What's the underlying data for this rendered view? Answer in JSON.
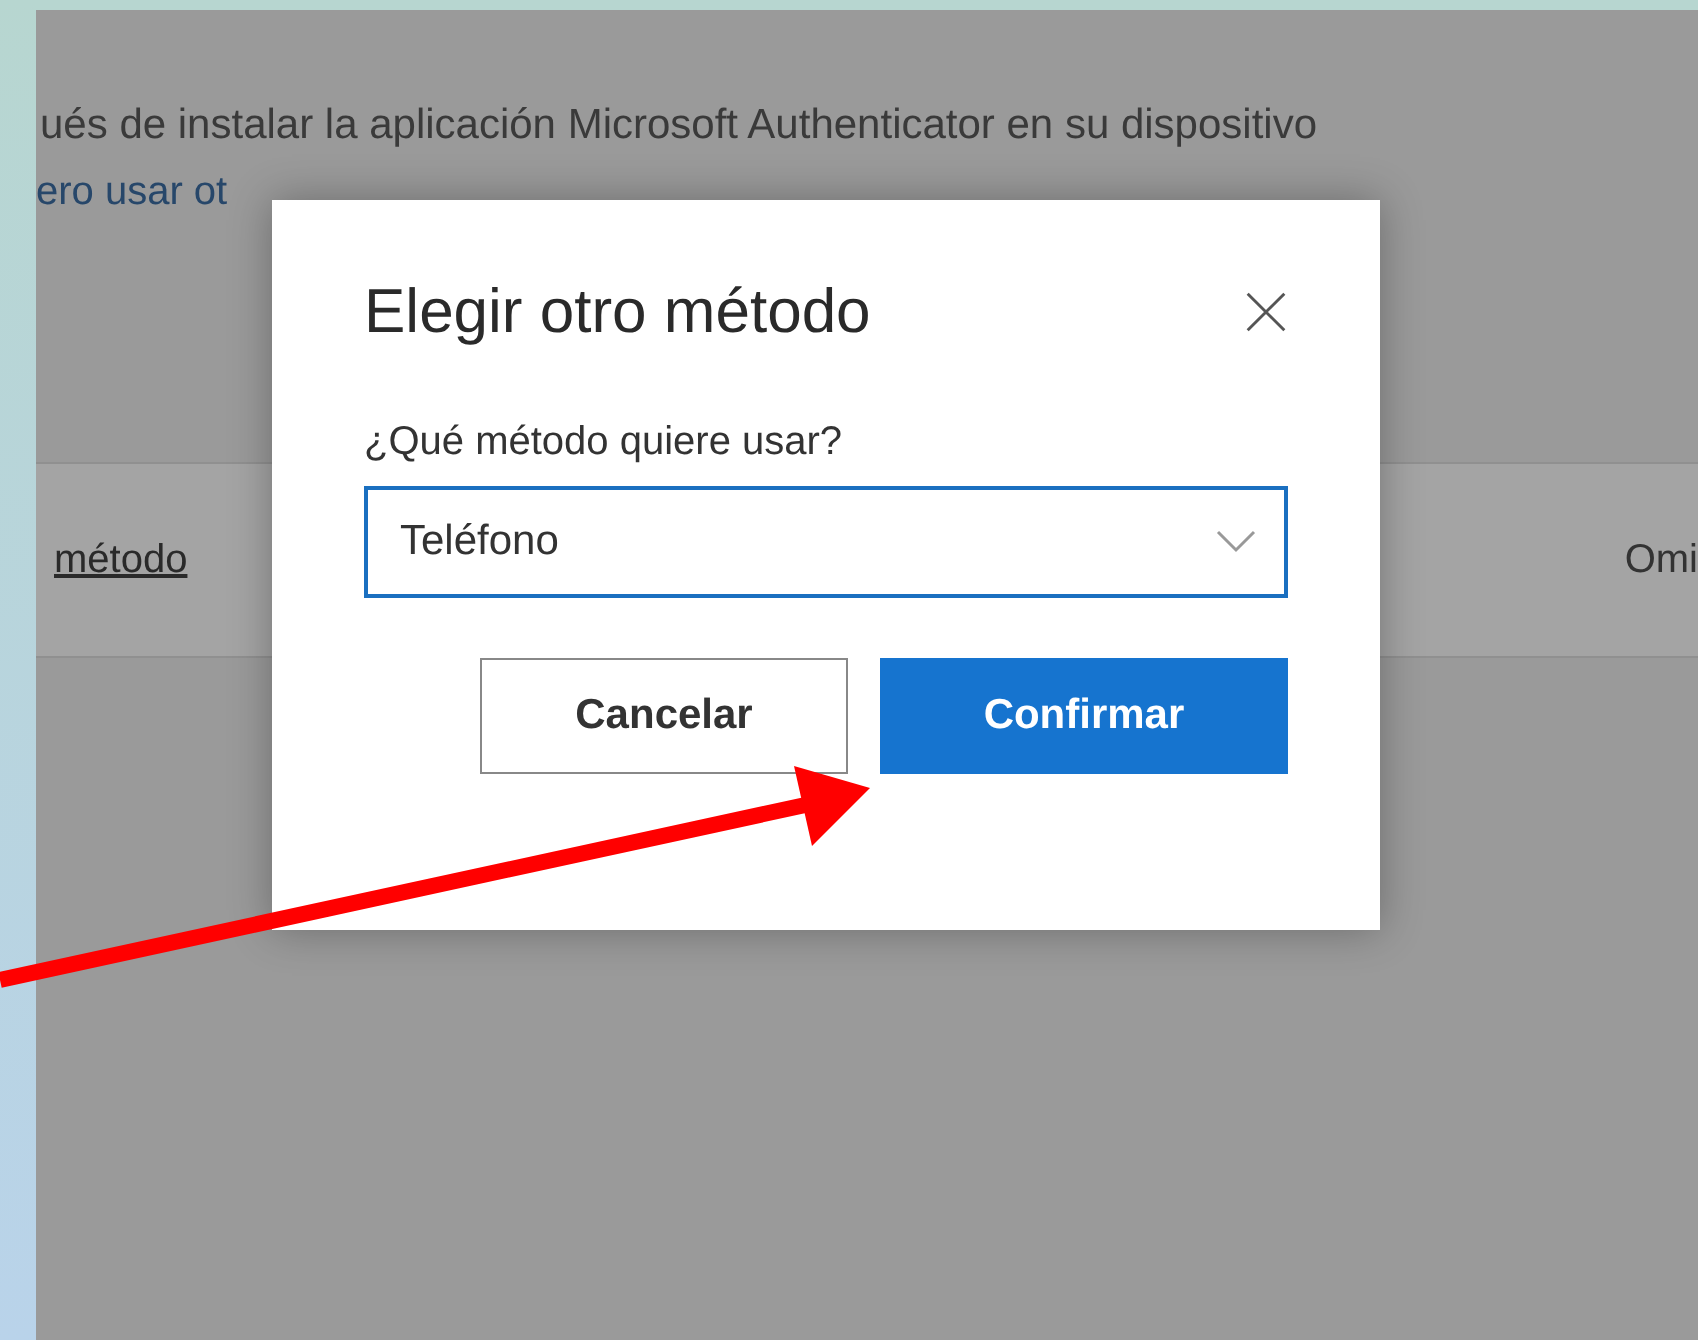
{
  "background": {
    "intro_text": "ués de instalar la aplicación Microsoft Authenticator en su dispositivo",
    "link": "ero usar ot",
    "band": {
      "link": "método",
      "action": "Omi"
    }
  },
  "dialog": {
    "title": "Elegir otro método",
    "question": "¿Qué método quiere usar?",
    "select": {
      "value": "Teléfono"
    },
    "buttons": [
      {
        "label": "Cancelar",
        "kind": "secondary"
      },
      {
        "label": "Confirmar",
        "kind": "primary"
      }
    ]
  }
}
